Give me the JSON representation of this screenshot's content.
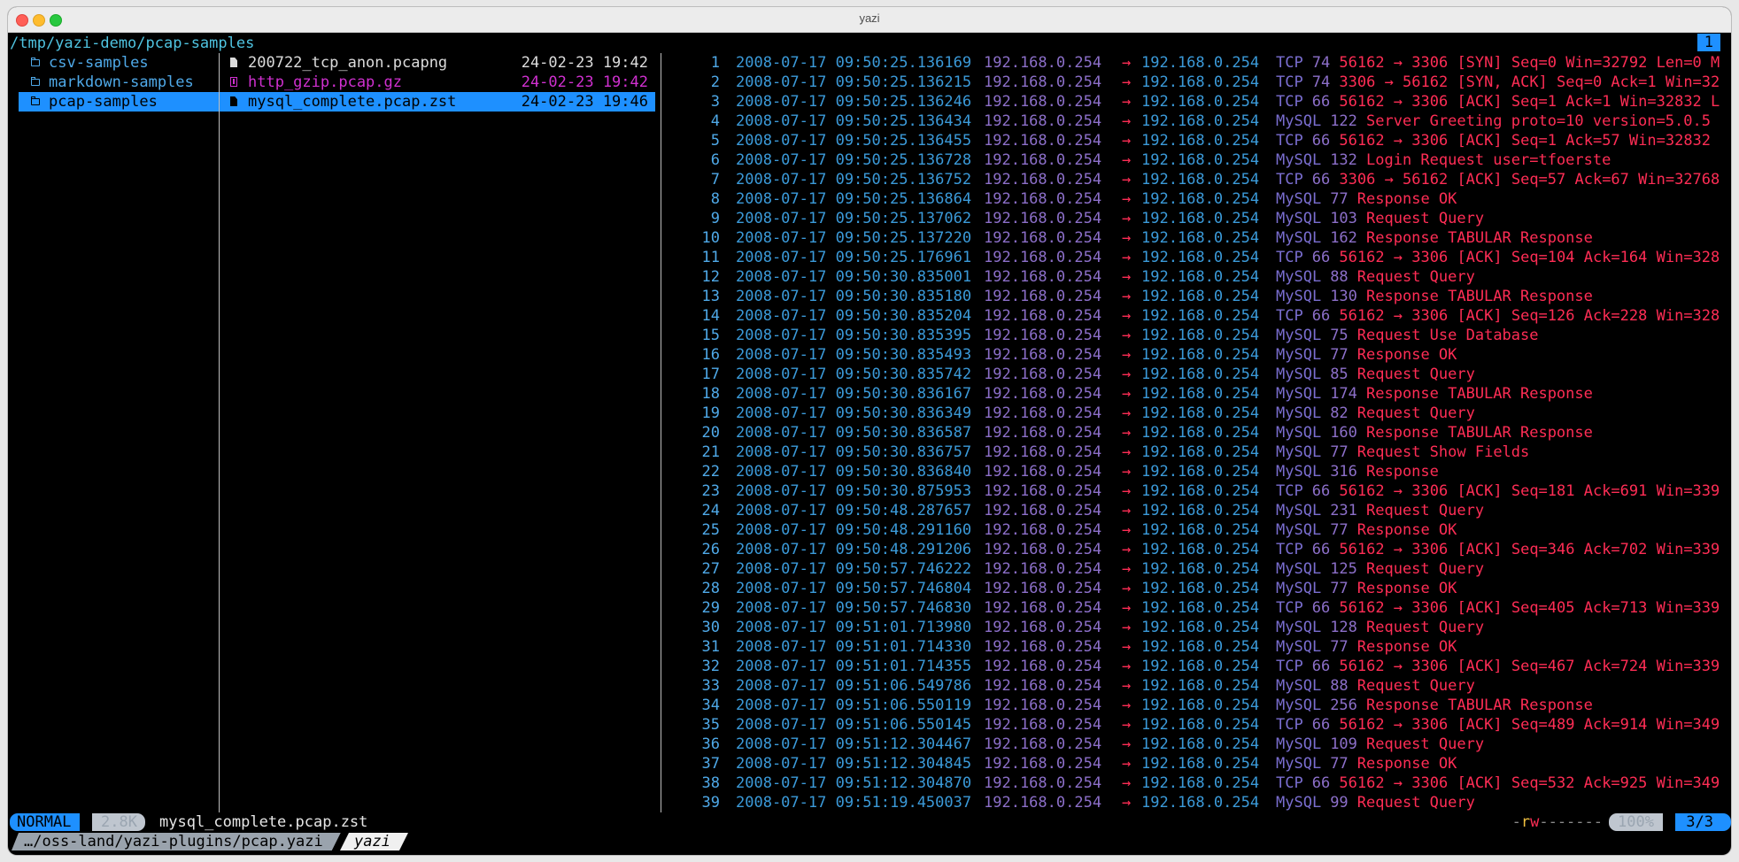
{
  "window": {
    "title": "yazi"
  },
  "header": {
    "cwd": "/tmp/yazi-demo/pcap-samples",
    "tab_number": "1"
  },
  "parent_pane": {
    "items": [
      {
        "label": "csv-samples",
        "selected": false
      },
      {
        "label": "markdown-samples",
        "selected": false
      },
      {
        "label": "pcap-samples",
        "selected": true
      }
    ]
  },
  "current_pane": {
    "items": [
      {
        "name": "200722_tcp_anon.pcapng",
        "date": "24-02-23 19:42",
        "icon": "file",
        "style": "normal"
      },
      {
        "name": "http_gzip.pcap.gz",
        "date": "24-02-23 19:42",
        "icon": "archive",
        "style": "gz"
      },
      {
        "name": "mysql_complete.pcap.zst",
        "date": "24-02-23 19:46",
        "icon": "file",
        "style": "sel"
      }
    ]
  },
  "preview": {
    "arrow": "→",
    "packets": [
      {
        "no": "1",
        "time": "2008-07-17 09:50:25.136169",
        "src": "192.168.0.254",
        "dst": "192.168.0.254",
        "proto": "TCP",
        "len": "74",
        "info": "56162 → 3306 [SYN] Seq=0 Win=32792 Len=0 M"
      },
      {
        "no": "2",
        "time": "2008-07-17 09:50:25.136215",
        "src": "192.168.0.254",
        "dst": "192.168.0.254",
        "proto": "TCP",
        "len": "74",
        "info": "3306 → 56162 [SYN, ACK] Seq=0 Ack=1 Win=32"
      },
      {
        "no": "3",
        "time": "2008-07-17 09:50:25.136246",
        "src": "192.168.0.254",
        "dst": "192.168.0.254",
        "proto": "TCP",
        "len": "66",
        "info": "56162 → 3306 [ACK] Seq=1 Ack=1 Win=32832 L"
      },
      {
        "no": "4",
        "time": "2008-07-17 09:50:25.136434",
        "src": "192.168.0.254",
        "dst": "192.168.0.254",
        "proto": "MySQL",
        "len": "122",
        "info": "Server Greeting  proto=10 version=5.0.5"
      },
      {
        "no": "5",
        "time": "2008-07-17 09:50:25.136455",
        "src": "192.168.0.254",
        "dst": "192.168.0.254",
        "proto": "TCP",
        "len": "66",
        "info": "56162 → 3306 [ACK] Seq=1 Ack=57 Win=32832"
      },
      {
        "no": "6",
        "time": "2008-07-17 09:50:25.136728",
        "src": "192.168.0.254",
        "dst": "192.168.0.254",
        "proto": "MySQL",
        "len": "132",
        "info": "Login Request user=tfoerste"
      },
      {
        "no": "7",
        "time": "2008-07-17 09:50:25.136752",
        "src": "192.168.0.254",
        "dst": "192.168.0.254",
        "proto": "TCP",
        "len": "66",
        "info": "3306 → 56162 [ACK] Seq=57 Ack=67 Win=32768"
      },
      {
        "no": "8",
        "time": "2008-07-17 09:50:25.136864",
        "src": "192.168.0.254",
        "dst": "192.168.0.254",
        "proto": "MySQL",
        "len": "77",
        "info": "Response  OK"
      },
      {
        "no": "9",
        "time": "2008-07-17 09:50:25.137062",
        "src": "192.168.0.254",
        "dst": "192.168.0.254",
        "proto": "MySQL",
        "len": "103",
        "info": "Request Query"
      },
      {
        "no": "10",
        "time": "2008-07-17 09:50:25.137220",
        "src": "192.168.0.254",
        "dst": "192.168.0.254",
        "proto": "MySQL",
        "len": "162",
        "info": "Response TABULAR Response"
      },
      {
        "no": "11",
        "time": "2008-07-17 09:50:25.176961",
        "src": "192.168.0.254",
        "dst": "192.168.0.254",
        "proto": "TCP",
        "len": "66",
        "info": "56162 → 3306 [ACK] Seq=104 Ack=164 Win=328"
      },
      {
        "no": "12",
        "time": "2008-07-17 09:50:30.835001",
        "src": "192.168.0.254",
        "dst": "192.168.0.254",
        "proto": "MySQL",
        "len": "88",
        "info": "Request Query"
      },
      {
        "no": "13",
        "time": "2008-07-17 09:50:30.835180",
        "src": "192.168.0.254",
        "dst": "192.168.0.254",
        "proto": "MySQL",
        "len": "130",
        "info": "Response TABULAR Response"
      },
      {
        "no": "14",
        "time": "2008-07-17 09:50:30.835204",
        "src": "192.168.0.254",
        "dst": "192.168.0.254",
        "proto": "TCP",
        "len": "66",
        "info": "56162 → 3306 [ACK] Seq=126 Ack=228 Win=328"
      },
      {
        "no": "15",
        "time": "2008-07-17 09:50:30.835395",
        "src": "192.168.0.254",
        "dst": "192.168.0.254",
        "proto": "MySQL",
        "len": "75",
        "info": "Request Use Database"
      },
      {
        "no": "16",
        "time": "2008-07-17 09:50:30.835493",
        "src": "192.168.0.254",
        "dst": "192.168.0.254",
        "proto": "MySQL",
        "len": "77",
        "info": "Response  OK"
      },
      {
        "no": "17",
        "time": "2008-07-17 09:50:30.835742",
        "src": "192.168.0.254",
        "dst": "192.168.0.254",
        "proto": "MySQL",
        "len": "85",
        "info": "Request Query"
      },
      {
        "no": "18",
        "time": "2008-07-17 09:50:30.836167",
        "src": "192.168.0.254",
        "dst": "192.168.0.254",
        "proto": "MySQL",
        "len": "174",
        "info": "Response TABULAR Response"
      },
      {
        "no": "19",
        "time": "2008-07-17 09:50:30.836349",
        "src": "192.168.0.254",
        "dst": "192.168.0.254",
        "proto": "MySQL",
        "len": "82",
        "info": "Request Query"
      },
      {
        "no": "20",
        "time": "2008-07-17 09:50:30.836587",
        "src": "192.168.0.254",
        "dst": "192.168.0.254",
        "proto": "MySQL",
        "len": "160",
        "info": "Response TABULAR Response"
      },
      {
        "no": "21",
        "time": "2008-07-17 09:50:30.836757",
        "src": "192.168.0.254",
        "dst": "192.168.0.254",
        "proto": "MySQL",
        "len": "77",
        "info": "Request Show Fields"
      },
      {
        "no": "22",
        "time": "2008-07-17 09:50:30.836840",
        "src": "192.168.0.254",
        "dst": "192.168.0.254",
        "proto": "MySQL",
        "len": "316",
        "info": "Response"
      },
      {
        "no": "23",
        "time": "2008-07-17 09:50:30.875953",
        "src": "192.168.0.254",
        "dst": "192.168.0.254",
        "proto": "TCP",
        "len": "66",
        "info": "56162 → 3306 [ACK] Seq=181 Ack=691 Win=339"
      },
      {
        "no": "24",
        "time": "2008-07-17 09:50:48.287657",
        "src": "192.168.0.254",
        "dst": "192.168.0.254",
        "proto": "MySQL",
        "len": "231",
        "info": "Request Query"
      },
      {
        "no": "25",
        "time": "2008-07-17 09:50:48.291160",
        "src": "192.168.0.254",
        "dst": "192.168.0.254",
        "proto": "MySQL",
        "len": "77",
        "info": "Response  OK"
      },
      {
        "no": "26",
        "time": "2008-07-17 09:50:48.291206",
        "src": "192.168.0.254",
        "dst": "192.168.0.254",
        "proto": "TCP",
        "len": "66",
        "info": "56162 → 3306 [ACK] Seq=346 Ack=702 Win=339"
      },
      {
        "no": "27",
        "time": "2008-07-17 09:50:57.746222",
        "src": "192.168.0.254",
        "dst": "192.168.0.254",
        "proto": "MySQL",
        "len": "125",
        "info": "Request Query"
      },
      {
        "no": "28",
        "time": "2008-07-17 09:50:57.746804",
        "src": "192.168.0.254",
        "dst": "192.168.0.254",
        "proto": "MySQL",
        "len": "77",
        "info": "Response  OK"
      },
      {
        "no": "29",
        "time": "2008-07-17 09:50:57.746830",
        "src": "192.168.0.254",
        "dst": "192.168.0.254",
        "proto": "TCP",
        "len": "66",
        "info": "56162 → 3306 [ACK] Seq=405 Ack=713 Win=339"
      },
      {
        "no": "30",
        "time": "2008-07-17 09:51:01.713980",
        "src": "192.168.0.254",
        "dst": "192.168.0.254",
        "proto": "MySQL",
        "len": "128",
        "info": "Request Query"
      },
      {
        "no": "31",
        "time": "2008-07-17 09:51:01.714330",
        "src": "192.168.0.254",
        "dst": "192.168.0.254",
        "proto": "MySQL",
        "len": "77",
        "info": "Response  OK"
      },
      {
        "no": "32",
        "time": "2008-07-17 09:51:01.714355",
        "src": "192.168.0.254",
        "dst": "192.168.0.254",
        "proto": "TCP",
        "len": "66",
        "info": "56162 → 3306 [ACK] Seq=467 Ack=724 Win=339"
      },
      {
        "no": "33",
        "time": "2008-07-17 09:51:06.549786",
        "src": "192.168.0.254",
        "dst": "192.168.0.254",
        "proto": "MySQL",
        "len": "88",
        "info": "Request Query"
      },
      {
        "no": "34",
        "time": "2008-07-17 09:51:06.550119",
        "src": "192.168.0.254",
        "dst": "192.168.0.254",
        "proto": "MySQL",
        "len": "256",
        "info": "Response TABULAR Response"
      },
      {
        "no": "35",
        "time": "2008-07-17 09:51:06.550145",
        "src": "192.168.0.254",
        "dst": "192.168.0.254",
        "proto": "TCP",
        "len": "66",
        "info": "56162 → 3306 [ACK] Seq=489 Ack=914 Win=349"
      },
      {
        "no": "36",
        "time": "2008-07-17 09:51:12.304467",
        "src": "192.168.0.254",
        "dst": "192.168.0.254",
        "proto": "MySQL",
        "len": "109",
        "info": "Request Query"
      },
      {
        "no": "37",
        "time": "2008-07-17 09:51:12.304845",
        "src": "192.168.0.254",
        "dst": "192.168.0.254",
        "proto": "MySQL",
        "len": "77",
        "info": "Response  OK"
      },
      {
        "no": "38",
        "time": "2008-07-17 09:51:12.304870",
        "src": "192.168.0.254",
        "dst": "192.168.0.254",
        "proto": "TCP",
        "len": "66",
        "info": "56162 → 3306 [ACK] Seq=532 Ack=925 Win=349"
      },
      {
        "no": "39",
        "time": "2008-07-17 09:51:19.450037",
        "src": "192.168.0.254",
        "dst": "192.168.0.254",
        "proto": "MySQL",
        "len": "99",
        "info": "Request Query"
      }
    ]
  },
  "status": {
    "mode": "NORMAL",
    "size": "2.8K",
    "filename": "mysql_complete.pcap.zst",
    "perm_r": "r",
    "perm_w": "w",
    "perm_dashes_pre": "-",
    "perm_dashes_post": "-------",
    "percent": "100%",
    "position": "3/3"
  },
  "tabs": {
    "path": "…/oss-land/yazi-plugins/pcap.yazi",
    "active": "yazi"
  },
  "colors": {
    "accent": "#1e90ff",
    "info": "#ff2d55",
    "directory": "#4fa9e8",
    "archive": "#d030d0"
  }
}
